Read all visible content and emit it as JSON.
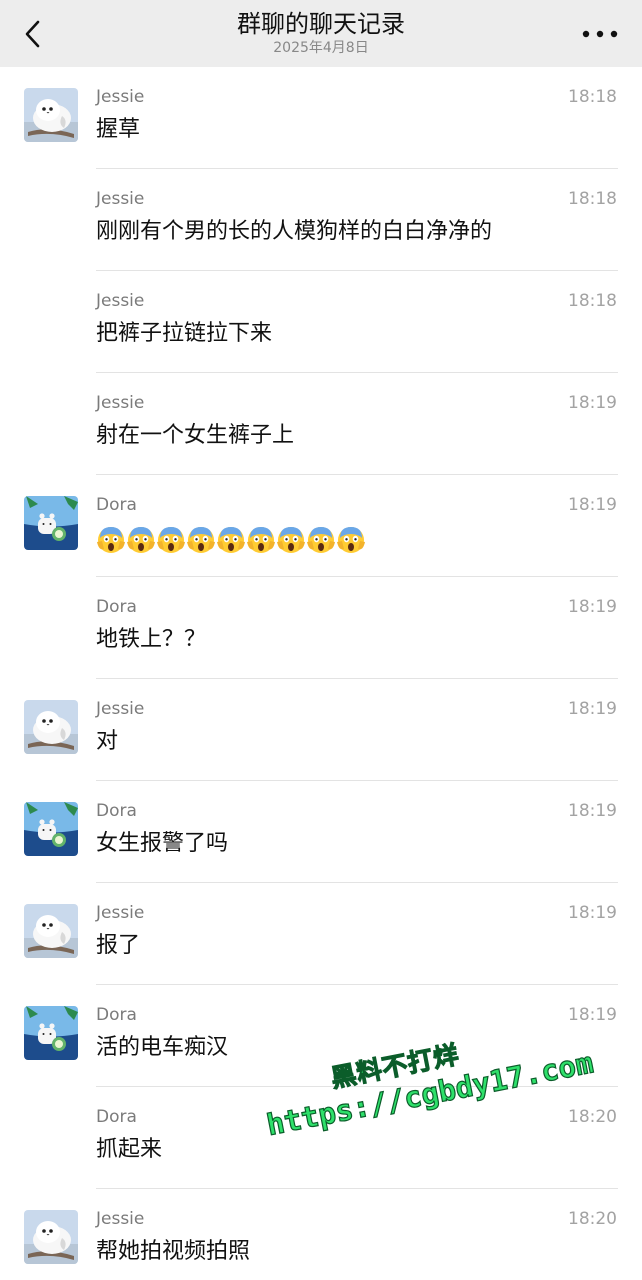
{
  "header": {
    "title": "群聊的聊天记录",
    "subtitle": "2025年4月8日"
  },
  "icons": {
    "back": "chevron-left-icon",
    "more": "more-dots-icon",
    "avatar_jessie": "white-bird-avatar",
    "avatar_dora": "cat-beach-avatar",
    "emoji": "screaming-face-emoji"
  },
  "colors": {
    "nav_bg": "#ededed",
    "sender": "#7b7b7b",
    "time": "#a3a3a3",
    "watermark": "#2ee06a"
  },
  "messages": [
    {
      "sender": "Jessie",
      "time": "18:18",
      "text": "握草",
      "avatar": "jessie",
      "emoji_count": 0
    },
    {
      "sender": "Jessie",
      "time": "18:18",
      "text": "刚刚有个男的长的人模狗样的白白净净的",
      "avatar": "",
      "emoji_count": 0
    },
    {
      "sender": "Jessie",
      "time": "18:18",
      "text": "把裤子拉链拉下来",
      "avatar": "",
      "emoji_count": 0
    },
    {
      "sender": "Jessie",
      "time": "18:19",
      "text": "射在一个女生裤子上",
      "avatar": "",
      "emoji_count": 0
    },
    {
      "sender": "Dora",
      "time": "18:19",
      "text": "",
      "avatar": "dora",
      "emoji_count": 9
    },
    {
      "sender": "Dora",
      "time": "18:19",
      "text": "地铁上？？",
      "avatar": "",
      "emoji_count": 0
    },
    {
      "sender": "Jessie",
      "time": "18:19",
      "text": "对",
      "avatar": "jessie",
      "emoji_count": 0
    },
    {
      "sender": "Dora",
      "time": "18:19",
      "text": "女生报警了吗",
      "avatar": "dora",
      "emoji_count": 0
    },
    {
      "sender": "Jessie",
      "time": "18:19",
      "text": "报了",
      "avatar": "jessie",
      "emoji_count": 0
    },
    {
      "sender": "Dora",
      "time": "18:19",
      "text": "活的电车痴汉",
      "avatar": "dora",
      "emoji_count": 0
    },
    {
      "sender": "Dora",
      "time": "18:20",
      "text": "抓起来",
      "avatar": "",
      "emoji_count": 0
    },
    {
      "sender": "Jessie",
      "time": "18:20",
      "text": "帮她拍视频拍照",
      "avatar": "jessie",
      "emoji_count": 0
    }
  ],
  "watermark": {
    "line1": "黑料不打烊",
    "line2": "https://cgbdy17.com"
  }
}
